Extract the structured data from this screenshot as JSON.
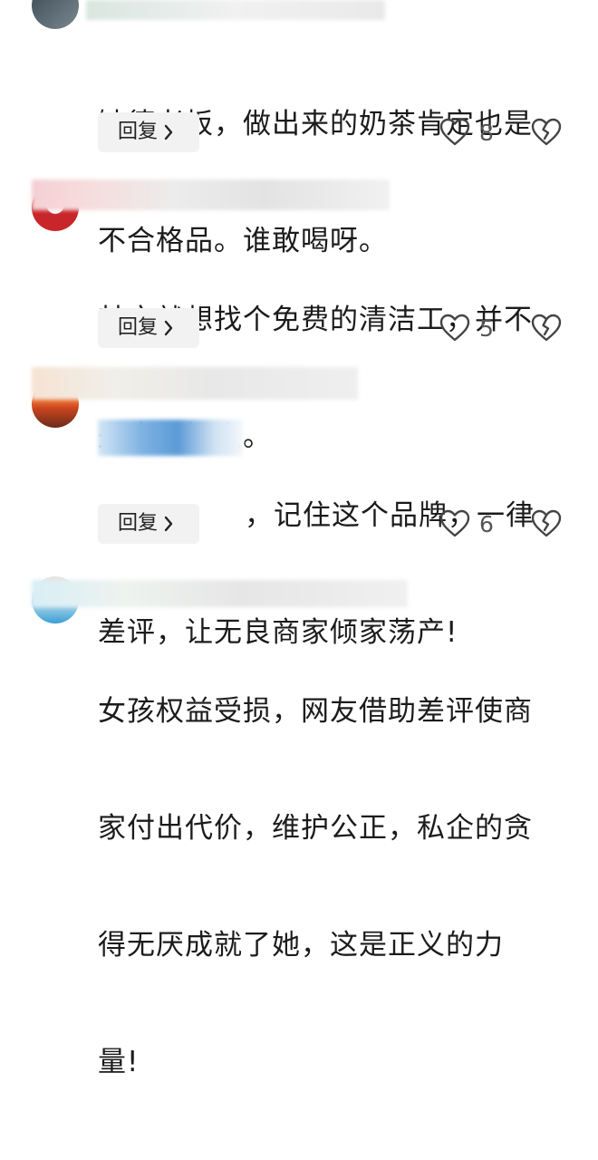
{
  "comments": [
    {
      "text_lines": [
        "缺德老板，做出来的奶茶肯定也是",
        "不合格品。谁敢喝呀。"
      ],
      "reply_label": "回复",
      "like_count": "8"
    },
    {
      "text_lines": [
        "其实就想找个免费的清洁工，并不",
        "是真正招人。"
      ],
      "reply_label": "回复",
      "like_count": "5"
    },
    {
      "text_lines": [
        "，记住这个品牌，一律",
        "差评，让无良商家倾家荡产!"
      ],
      "reply_label": "回复",
      "like_count": "6"
    },
    {
      "text_lines": [
        "女孩权益受损，网友借助差评使商",
        "家付出代价，维护公正，私企的贪",
        "得无厌成就了她，这是正义的力",
        "量!"
      ]
    }
  ],
  "icons": {
    "like": "heart-outline-icon",
    "dislike": "broken-heart-icon",
    "reply_chevron": "chevron-right-icon"
  },
  "colors": {
    "reply_bg": "#f2f2f2",
    "icon": "#444444",
    "text": "#1b1b1b"
  }
}
